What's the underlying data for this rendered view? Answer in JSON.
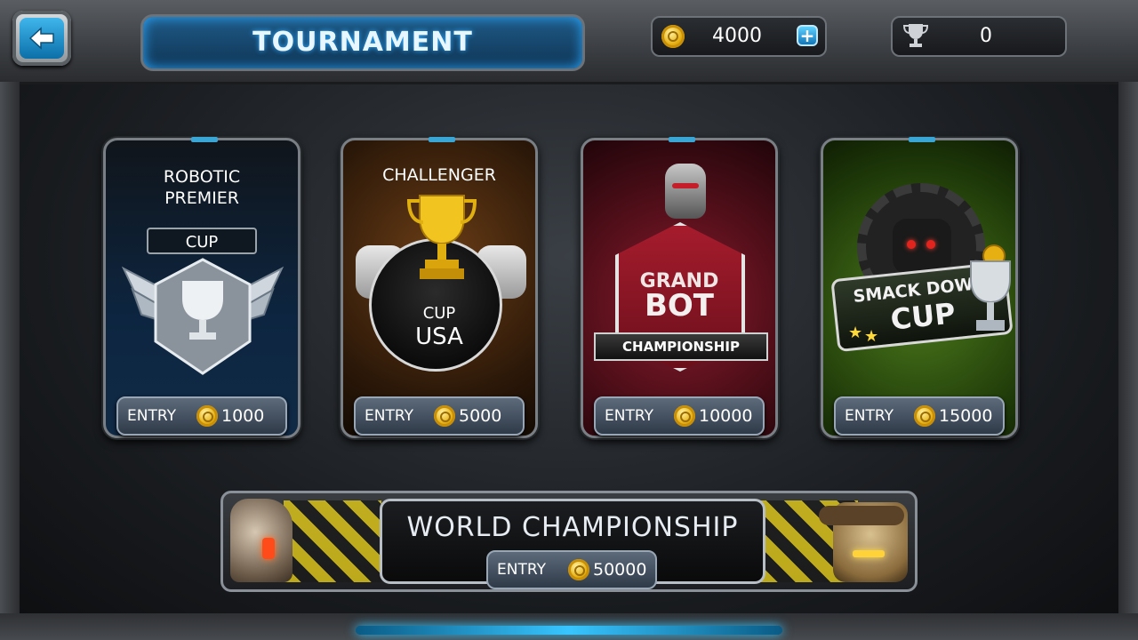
{
  "header": {
    "title": "TOURNAMENT",
    "coins": "4000",
    "trophies": "0"
  },
  "tournaments": [
    {
      "title_line1": "ROBOTIC",
      "title_line2": "PREMIER",
      "badge_text": "CUP",
      "entry_label": "ENTRY",
      "entry_cost": "1000"
    },
    {
      "title_line1": "CHALLENGER",
      "badge_cup": "CUP",
      "badge_text": "USA",
      "entry_label": "ENTRY",
      "entry_cost": "5000"
    },
    {
      "logo_line1": "GRAND",
      "logo_line2": "BOT",
      "logo_line3": "CHAMPIONSHIP",
      "entry_label": "ENTRY",
      "entry_cost": "10000"
    },
    {
      "logo_line1": "SMACK DOWN",
      "logo_line2": "CUP",
      "entry_label": "ENTRY",
      "entry_cost": "15000"
    }
  ],
  "world": {
    "title": "WORLD CHAMPIONSHIP",
    "entry_label": "ENTRY",
    "entry_cost": "50000"
  },
  "icons": {
    "back": "back-arrow-icon",
    "coin": "coin-icon",
    "plus": "plus-icon",
    "trophy": "trophy-icon"
  },
  "colors": {
    "accent_blue": "#38c5ff",
    "coin_gold": "#e6b012",
    "grand_red": "#a61c2d",
    "smack_green": "#4c7a1c"
  }
}
